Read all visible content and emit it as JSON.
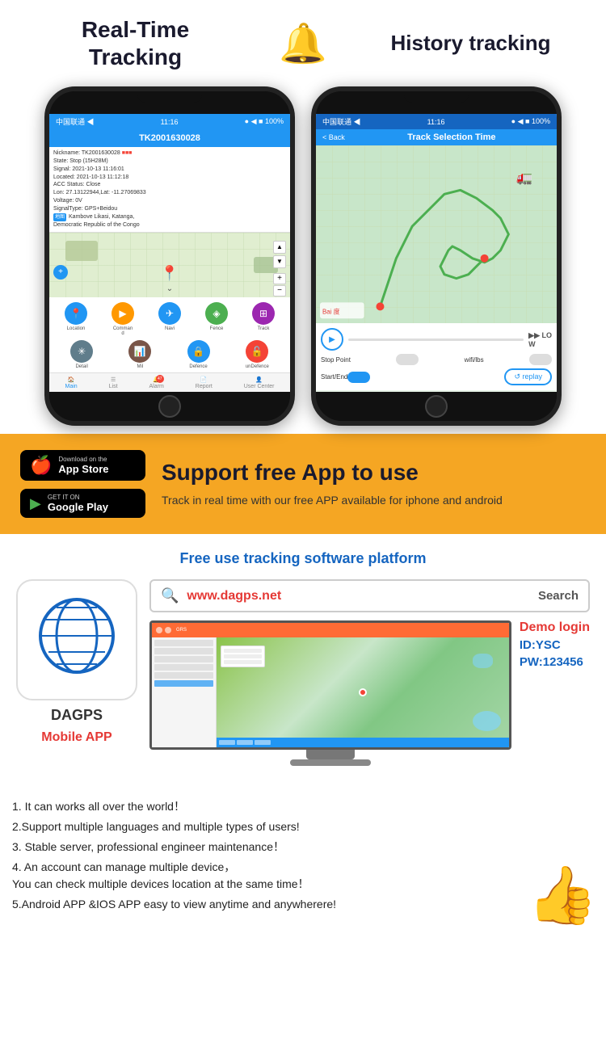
{
  "header": {
    "title_realtime": "Real-Time\nTracking",
    "title_history": "History tracking",
    "bell_icon": "🔔"
  },
  "phones": {
    "left": {
      "status_bar": "中国联通 ◀  11:16  ● ◀ ■ 100%",
      "title": "TK2001630028",
      "info_lines": [
        "Nickname: TK2001630028",
        "State: Stop (15H28M)",
        "Signal: 2021-10-13 11:16:01",
        "Located: 2021-10-13 11:12:18",
        "ACC Status: Close",
        "Lon: 27.13122944, Lat: -11.27069833",
        "Voltage: 0V",
        "SignalType: GPS+Beidou",
        "Kambove Likasi, Katanga,",
        "Democratic Republic of the Congo"
      ],
      "action_buttons": [
        {
          "label": "Location",
          "color": "#2196F3",
          "icon": "📍"
        },
        {
          "label": "Command",
          "color": "#FF9800",
          "icon": "▶"
        },
        {
          "label": "Navi",
          "color": "#2196F3",
          "icon": "✈"
        },
        {
          "label": "Fence",
          "color": "#4CAF50",
          "icon": "◈"
        },
        {
          "label": "Track",
          "color": "#9C27B0",
          "icon": "⊞"
        }
      ],
      "action_buttons2": [
        {
          "label": "Detail",
          "color": "#607D8B",
          "icon": "✳"
        },
        {
          "label": "Mil",
          "color": "#795548",
          "icon": "📊"
        },
        {
          "label": "Defence",
          "color": "#2196F3",
          "icon": "🔒"
        },
        {
          "label": "unDefence",
          "color": "#F44336",
          "icon": "🔓"
        }
      ],
      "tabs": [
        "Main",
        "List",
        "Alarm",
        "Report",
        "User Center"
      ]
    },
    "right": {
      "status_bar": "中国联通 ◀  11:16  ● ◀ ■ 100%",
      "back_label": "< Back",
      "title": "Track Selection Time",
      "controls": {
        "stop_point": "Stop Point",
        "wifi_lbs": "wifi/lbs",
        "start_end": "Start/End",
        "replay": "↺ replay",
        "speed": "LO W"
      }
    }
  },
  "middle": {
    "app_store_label_sub": "Download on the",
    "app_store_label_main": "App Store",
    "google_play_label_sub": "GET IT ON",
    "google_play_label_main": "Google Play",
    "title": "Support free App to use",
    "description": "Track in real time with our free APP available for iphone and android"
  },
  "platform": {
    "title": "Free use tracking software platform",
    "search_placeholder": "www.dagps.net",
    "search_button": "Search",
    "search_icon": "🔍",
    "app_name": "DAGPS",
    "mobile_app_label": "Mobile APP",
    "demo_login": {
      "title": "Demo login",
      "id_label": "ID:YSC",
      "pw_label": "PW:123456"
    }
  },
  "features": [
    "1. It can works all over the world！",
    "2.Support multiple languages and multiple types of users!",
    "3. Stable server, professional engineer maintenance！",
    "4. An account can manage multiple device，\nYou can check multiple devices location at the same time！",
    "5.Android APP &IOS APP easy to view anytime and anywherere!"
  ]
}
